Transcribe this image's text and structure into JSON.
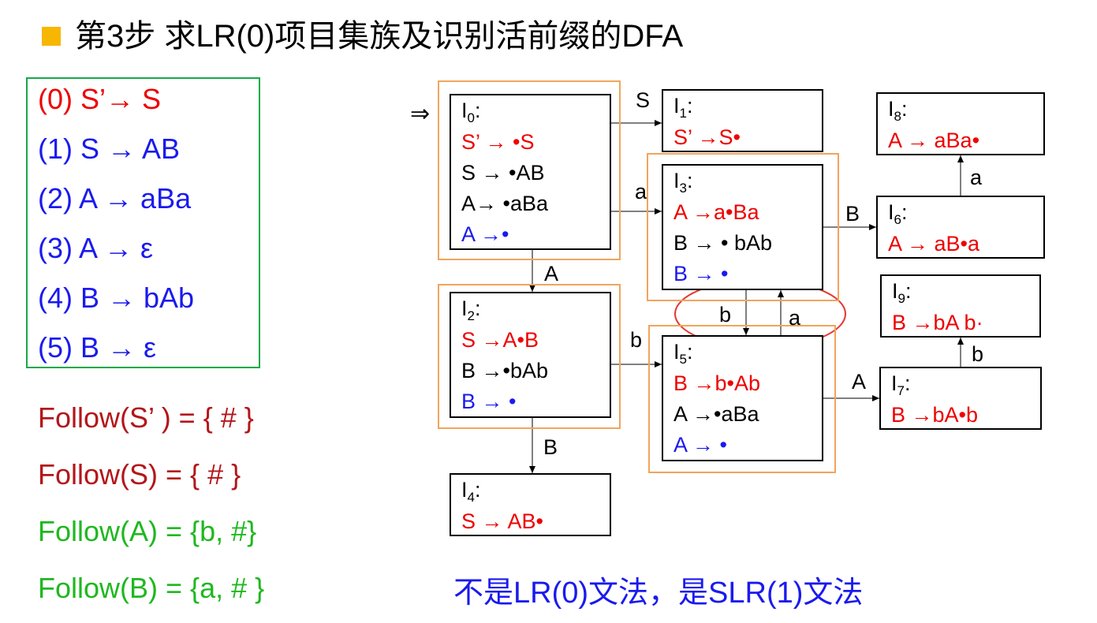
{
  "title": "第3步 求LR(0)项目集族及识别活前缀的DFA",
  "grammar": [
    {
      "text": "(0) S’→ S",
      "color": "red"
    },
    {
      "text": "(1) S →  AB",
      "color": "blue"
    },
    {
      "text": "(2) A → aBa",
      "color": "blue"
    },
    {
      "text": "(3) A → ε",
      "color": "blue"
    },
    {
      "text": "(4) B → bAb",
      "color": "blue"
    },
    {
      "text": "(5) B → ε",
      "color": "blue"
    }
  ],
  "follow": [
    {
      "text": "Follow(S’ ) = { # }",
      "color": "dkred"
    },
    {
      "text": "Follow(S) = { # }",
      "color": "dkred"
    },
    {
      "text": "Follow(A) = {b, #}",
      "color": "green"
    },
    {
      "text": "Follow(B) = {a, # }",
      "color": "green"
    }
  ],
  "start_arrow": "⇒",
  "states": [
    {
      "id": "I0",
      "name": "I",
      "sub": "0",
      "items": [
        {
          "text": "S’   → •S",
          "color": "red"
        },
        {
          "text": "S → •AB",
          "color": "black"
        },
        {
          "text": "A→ •aBa",
          "color": "black"
        },
        {
          "text": "A →•",
          "color": "blue"
        }
      ]
    },
    {
      "id": "I1",
      "name": "I",
      "sub": "1",
      "items": [
        {
          "text": "S’   →S•",
          "color": "red"
        }
      ]
    },
    {
      "id": "I2",
      "name": "I",
      "sub": "2",
      "items": [
        {
          "text": "S →A•B",
          "color": "red"
        },
        {
          "text": "B →•bAb",
          "color": "black"
        },
        {
          "text": "B → •",
          "color": "blue"
        }
      ]
    },
    {
      "id": "I3",
      "name": "I",
      "sub": "3",
      "items": [
        {
          "text": "A →a•Ba",
          "color": "red"
        },
        {
          "text": "B → • bAb",
          "color": "black"
        },
        {
          "text": "B → •",
          "color": "blue"
        }
      ]
    },
    {
      "id": "I4",
      "name": "I",
      "sub": "4",
      "items": [
        {
          "text": "S → AB•",
          "color": "red"
        }
      ]
    },
    {
      "id": "I5",
      "name": "I",
      "sub": "5",
      "items": [
        {
          "text": "B →b•Ab",
          "color": "red"
        },
        {
          "text": "A →•aBa",
          "color": "black"
        },
        {
          "text": "A → •",
          "color": "blue"
        }
      ]
    },
    {
      "id": "I6",
      "name": "I",
      "sub": "6",
      "items": [
        {
          "text": "A → aB•a",
          "color": "red"
        }
      ]
    },
    {
      "id": "I7",
      "name": "I",
      "sub": "7",
      "items": [
        {
          "text": "B →bA•b",
          "color": "red"
        }
      ]
    },
    {
      "id": "I8",
      "name": "I",
      "sub": "8",
      "items": [
        {
          "text": "A → aBa•",
          "color": "red"
        }
      ]
    },
    {
      "id": "I9",
      "name": "I",
      "sub": "9",
      "items": [
        {
          "text": "B →bA b·",
          "color": "red"
        }
      ]
    }
  ],
  "edges": [
    {
      "from": "I0",
      "to": "I1",
      "symbol": "S"
    },
    {
      "from": "I0",
      "to": "I3",
      "symbol": "a"
    },
    {
      "from": "I0",
      "to": "I2",
      "symbol": "A"
    },
    {
      "from": "I2",
      "to": "I5",
      "symbol": "b"
    },
    {
      "from": "I2",
      "to": "I4",
      "symbol": "B"
    },
    {
      "from": "I3",
      "to": "I6",
      "symbol": "B"
    },
    {
      "from": "I3",
      "to": "I5",
      "symbol": "b"
    },
    {
      "from": "I5",
      "to": "I3",
      "symbol": "a"
    },
    {
      "from": "I5",
      "to": "I7",
      "symbol": "A"
    },
    {
      "from": "I6",
      "to": "I8",
      "symbol": "a"
    },
    {
      "from": "I7",
      "to": "I9",
      "symbol": "b"
    }
  ],
  "conclusion": "不是LR(0)文法，是SLR(1)文法",
  "colors": {
    "red": "#ee0000",
    "blue": "#1a1aee",
    "dkred": "#b3161a",
    "green": "#1fb81f",
    "black": "#000000",
    "orange_frame": "#f0a55c",
    "grammar_frame": "#18a84a",
    "ellipse": "#e53935",
    "bullet": "#f7b600"
  }
}
